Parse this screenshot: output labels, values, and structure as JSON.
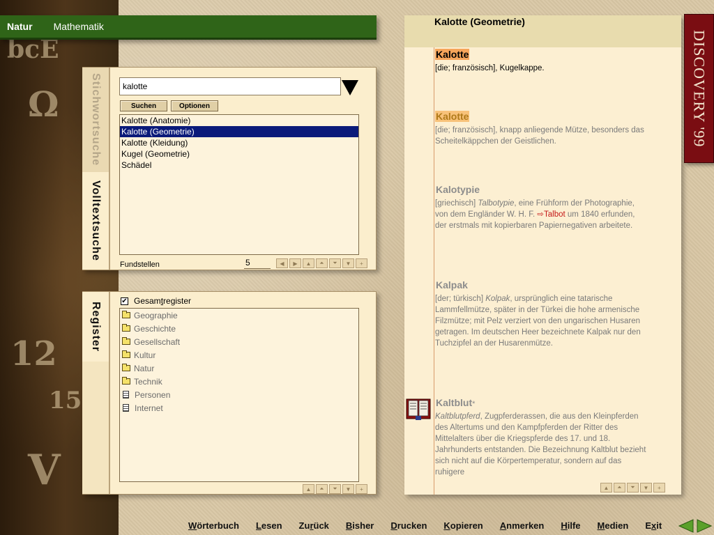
{
  "topbar": {
    "items": [
      {
        "label": "Natur",
        "active": true
      },
      {
        "label": "Mathematik",
        "active": false
      }
    ],
    "color": "#2f6418"
  },
  "search": {
    "tabs": {
      "keyword": "Stichwortsuche",
      "fulltext": "Volltextsuche"
    },
    "query": "kalotte",
    "buttons": {
      "search": "Suchen",
      "options": "Optionen"
    },
    "results": [
      {
        "label": "Kalotte (Anatomie)",
        "selected": false
      },
      {
        "label": "Kalotte (Geometrie)",
        "selected": true
      },
      {
        "label": "Kalotte (Kleidung)",
        "selected": false
      },
      {
        "label": "Kugel (Geometrie)",
        "selected": false
      },
      {
        "label": "Schädel",
        "selected": false
      }
    ],
    "fundstellen_label": "Fundstellen",
    "fundstellen_count": "5"
  },
  "register": {
    "tab": "Register",
    "checkbox_label_pre": "Gesam",
    "checkbox_label_u": "t",
    "checkbox_label_post": "register",
    "checkbox_mark": "✔",
    "items": [
      {
        "label": "Geographie",
        "icon": "folder"
      },
      {
        "label": "Geschichte",
        "icon": "folder"
      },
      {
        "label": "Gesellschaft",
        "icon": "folder"
      },
      {
        "label": "Kultur",
        "icon": "folder"
      },
      {
        "label": "Natur",
        "icon": "folder"
      },
      {
        "label": "Technik",
        "icon": "folder"
      },
      {
        "label": "Personen",
        "icon": "document"
      },
      {
        "label": "Internet",
        "icon": "document"
      }
    ]
  },
  "article": {
    "title": "Kalotte (Geometrie)",
    "entries": [
      {
        "headword": "Kalotte",
        "body": "[die; französisch], Kugelkappe."
      },
      {
        "headword": "Kalotte",
        "body": "[die; französisch], knapp anliegende Mütze, besonders das Scheitelkäppchen der Geistlichen."
      },
      {
        "headword": "Kalotypie",
        "body_pre": "[griechisch] ",
        "body_italic": "Talbotypie",
        "body_mid": ", eine Frühform der Photographie, von dem Engländer W. H. F. ",
        "xref": "⇨Talbot",
        "body_post": " um 1840 erfunden, der erstmals mit kopierbaren Papiernegativen arbeitete."
      },
      {
        "headword": "Kalpak",
        "body_pre": "[der; türkisch] ",
        "body_italic": "Kolpak",
        "body_post": ", ursprünglich eine tatarische Lammfellmütze, später in der Türkei die hohe armenische Filzmütze; mit Pelz verziert von den ungarischen Husaren getragen. Im deutschen Heer bezeichnete Kalpak nur den Tuchzipfel an der Husarenmütze."
      },
      {
        "headword": "Kaltblut",
        "star": "*",
        "body_italic": "Kaltblutpferd",
        "body_post": ", Zugpferderassen, die aus den Kleinpferden des Altertums und den Kampfpferden der Ritter des Mittelalters über die Kriegspferde des 17. und 18. Jahrhunderts entstanden. Die Bezeichnung Kaltblut bezieht sich nicht auf die Körpertemperatur, sondern auf das ruhigere"
      }
    ]
  },
  "brand": "DISCOVERY '99",
  "bottom_menu": [
    {
      "u": "W",
      "rest": "örterbuch"
    },
    {
      "u": "L",
      "rest": "esen"
    },
    {
      "pre": "Zu",
      "u": "r",
      "rest": "ück"
    },
    {
      "u": "B",
      "rest": "isher"
    },
    {
      "u": "D",
      "rest": "rucken"
    },
    {
      "u": "K",
      "rest": "opieren"
    },
    {
      "u": "A",
      "rest": "nmerken"
    },
    {
      "u": "H",
      "rest": "ilfe"
    },
    {
      "u": "M",
      "rest": "edien"
    },
    {
      "pre": "E",
      "u": "x",
      "rest": "it"
    }
  ],
  "icons": {
    "dropdown": "triangle-down-icon",
    "folder": "folder-icon",
    "document": "document-icon",
    "book": "book-icon",
    "back": "arrow-left-icon",
    "forward": "arrow-right-icon"
  }
}
